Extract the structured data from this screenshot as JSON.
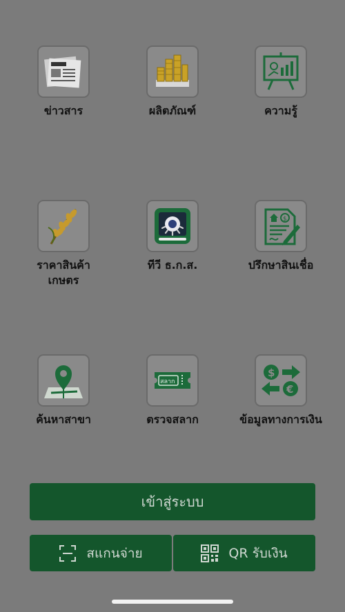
{
  "menu": [
    {
      "label": "ข่าวสาร",
      "icon": "newspaper-icon"
    },
    {
      "label": "ผลิตภัณฑ์",
      "icon": "gold-coins-icon"
    },
    {
      "label": "ความรู้",
      "icon": "presentation-board-icon"
    },
    {
      "label": "ราคาสินค้า\nเกษตร",
      "icon": "rice-plant-icon"
    },
    {
      "label": "ทีวี ธ.ก.ส.",
      "icon": "tv-logo-icon"
    },
    {
      "label": "ปรึกษาสินเชื่อ",
      "icon": "loan-document-icon"
    },
    {
      "label": "ค้นหาสาขา",
      "icon": "map-pin-icon"
    },
    {
      "label": "ตรวจสลาก",
      "icon": "lottery-ticket-icon"
    },
    {
      "label": "ข้อมูลทางการเงิน",
      "icon": "currency-exchange-icon"
    }
  ],
  "ticket_text": "สลาก",
  "buttons": {
    "login": "เข้าสู่ระบบ",
    "scan_pay": "สแกนจ่าย",
    "qr_receive": "QR รับเงิน"
  },
  "colors": {
    "background": "#7b7b7b",
    "button": "#14562c",
    "icon_green": "#1c6b3a"
  }
}
